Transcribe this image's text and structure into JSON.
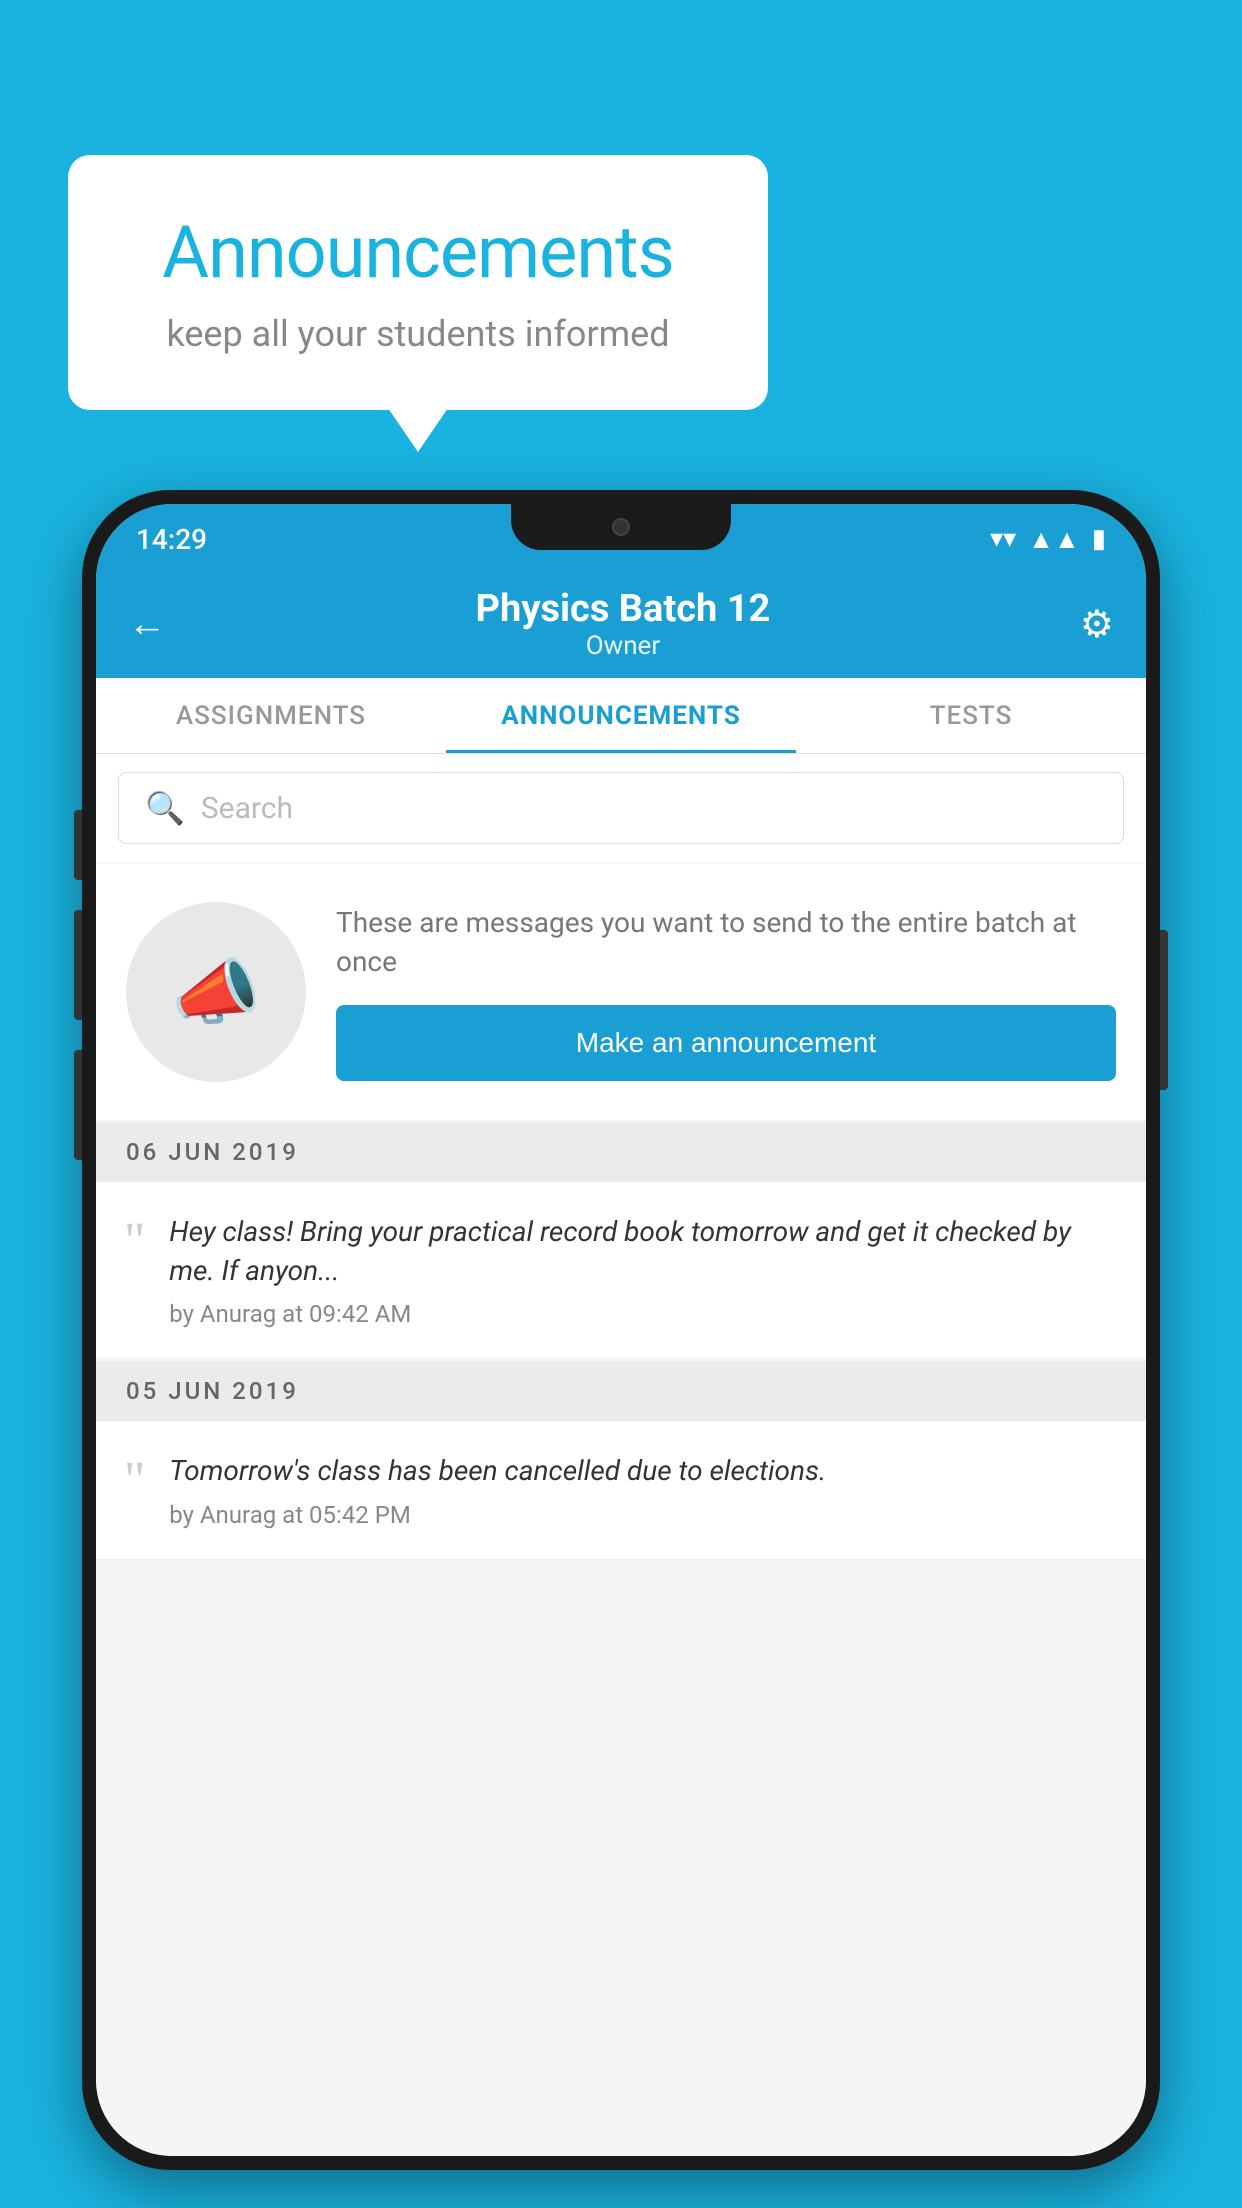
{
  "background": {
    "color": "#1ab3e0"
  },
  "speech_bubble": {
    "title": "Announcements",
    "subtitle": "keep all your students informed"
  },
  "phone": {
    "status_bar": {
      "time": "14:29",
      "wifi": "▲",
      "signal": "▲",
      "battery": "▮"
    },
    "header": {
      "back_label": "←",
      "title": "Physics Batch 12",
      "subtitle": "Owner",
      "settings_label": "⚙"
    },
    "tabs": [
      {
        "label": "ASSIGNMENTS",
        "active": false
      },
      {
        "label": "ANNOUNCEMENTS",
        "active": true
      },
      {
        "label": "TESTS",
        "active": false
      }
    ],
    "search": {
      "placeholder": "Search"
    },
    "promo": {
      "description": "These are messages you want to send to the entire batch at once",
      "button_label": "Make an announcement"
    },
    "announcements": [
      {
        "date": "06  JUN  2019",
        "text": "Hey class! Bring your practical record book tomorrow and get it checked by me. If anyon...",
        "meta": "by Anurag at 09:42 AM"
      },
      {
        "date": "05  JUN  2019",
        "text": "Tomorrow's class has been cancelled due to elections.",
        "meta": "by Anurag at 05:42 PM"
      }
    ]
  }
}
